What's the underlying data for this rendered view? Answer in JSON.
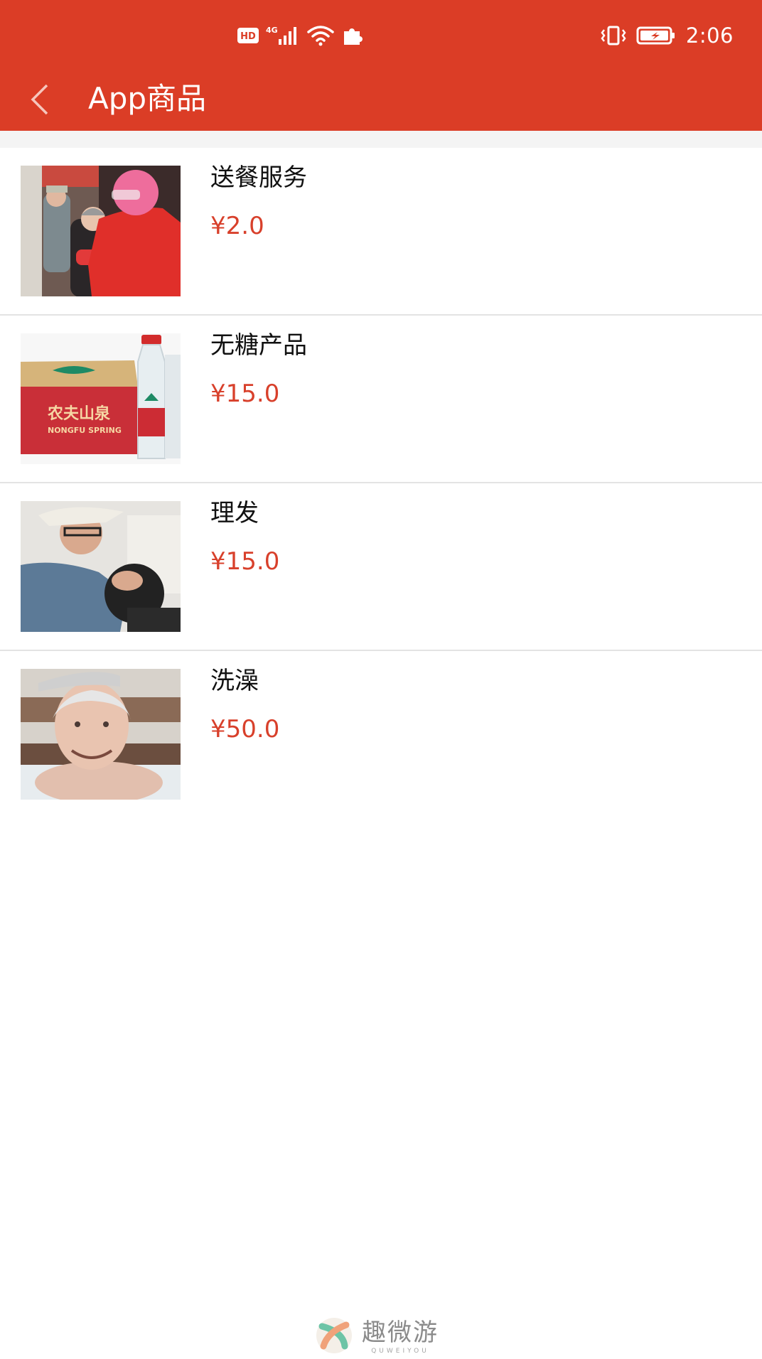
{
  "theme": {
    "accent": "#db3d26",
    "price_color": "#d8402b"
  },
  "status_bar": {
    "icons": [
      "hd-icon",
      "4g-signal-icon",
      "wifi-icon",
      "puzzle-icon",
      "vibrate-icon",
      "battery-charging-icon"
    ],
    "hd_label": "HD",
    "network_label": "4G",
    "time": "2:06"
  },
  "toolbar": {
    "back_icon": "chevron-left-icon",
    "title": "App商品"
  },
  "products": [
    {
      "name": "送餐服务",
      "price": "¥2.0",
      "image": "meal-delivery-photo"
    },
    {
      "name": "无糖产品",
      "price": "¥15.0",
      "image": "bottled-water-photo",
      "image_text": [
        "农夫山泉",
        "NONGFU SPRING"
      ]
    },
    {
      "name": "理发",
      "price": "¥15.0",
      "image": "haircut-photo"
    },
    {
      "name": "洗澡",
      "price": "¥50.0",
      "image": "bathing-photo"
    }
  ],
  "watermark": {
    "name": "趣微游",
    "subtitle": "QUWEIYOU"
  }
}
